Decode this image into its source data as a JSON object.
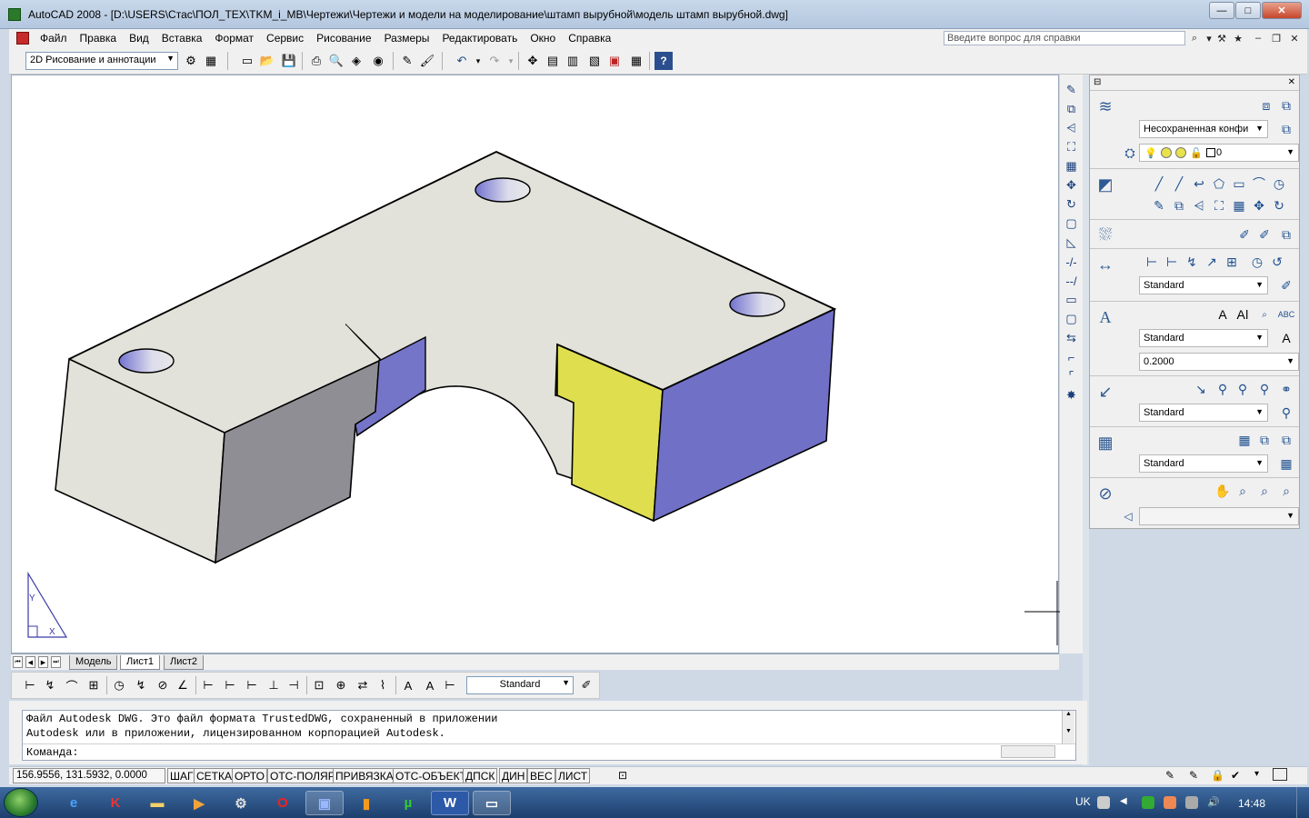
{
  "window": {
    "title": "AutoCAD 2008 - [D:\\USERS\\Стас\\ПОЛ_ТЕХ\\TKM_i_MB\\Чертежи\\Чертежи и модели на моделирование\\штамп вырубной\\модель штамп вырубной.dwg]",
    "minimize": "—",
    "maximize": "□",
    "close": "✕"
  },
  "menu": {
    "items": [
      "Файл",
      "Правка",
      "Вид",
      "Вставка",
      "Формат",
      "Сервис",
      "Рисование",
      "Размеры",
      "Редактировать",
      "Окно",
      "Справка"
    ],
    "help_placeholder": "Введите вопрос для справки"
  },
  "toolbar": {
    "workspace": "2D Рисование и аннотации"
  },
  "layout_tabs": [
    "Модель",
    "Лист1",
    "Лист2"
  ],
  "dim_toolbar": {
    "style": "Standard"
  },
  "command": {
    "line1": "Файл Autodesk DWG. Это файл формата TrustedDWG, сохраненный в приложении",
    "line2": "Autodesk или в приложении, лицензированном корпорацией Autodesk.",
    "prompt": "Команда:"
  },
  "status": {
    "coords": "156.9556, 131.5932, 0.0000",
    "buttons": [
      "ШАГ",
      "СЕТКА",
      "ОРТО",
      "ОТС-ПОЛЯР",
      "ПРИВЯЗКА",
      "ОТС-ОБЪЕКТ",
      "ДПСК",
      "ДИН",
      "ВЕС",
      "ЛИСТ"
    ]
  },
  "palette": {
    "layer_state": "Несохраненная конфи",
    "layer_current": "0",
    "dim_style": "Standard",
    "text_style": "Standard",
    "text_height": "0.2000",
    "mleader_style": "Standard",
    "table_style": "Standard"
  },
  "ucs": {
    "y": "Y",
    "x": "X"
  },
  "taskbar": {
    "lang": "UK",
    "time": "14:48"
  },
  "colors": {
    "top_face": "#e2e2da",
    "front_face": "#e2e2da",
    "shadow_face": "#8e8e94",
    "blue_face": "#7070c6",
    "yellow_face": "#dede4e"
  }
}
